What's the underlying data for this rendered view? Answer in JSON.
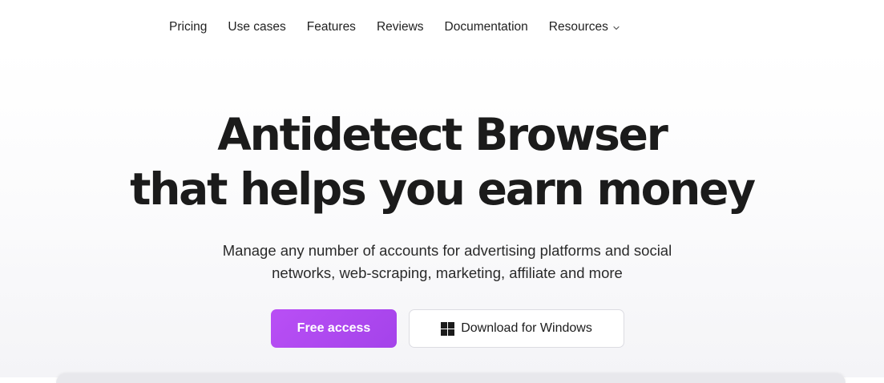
{
  "nav": {
    "items": [
      {
        "label": "Pricing"
      },
      {
        "label": "Use cases"
      },
      {
        "label": "Features"
      },
      {
        "label": "Reviews"
      },
      {
        "label": "Documentation"
      },
      {
        "label": "Resources",
        "icon": "chevron-down-icon"
      }
    ]
  },
  "hero": {
    "title_line1": "Antidetect Browser",
    "title_line2": "that helps you earn money",
    "subtitle_line1": "Manage any number of accounts for advertising platforms and social",
    "subtitle_line2": "networks, web-scraping, marketing, affiliate and more"
  },
  "buttons": {
    "primary_label": "Free access",
    "primary_color": "#b44cf0",
    "secondary_label": "Download for Windows",
    "secondary_icon": "windows-icon"
  }
}
